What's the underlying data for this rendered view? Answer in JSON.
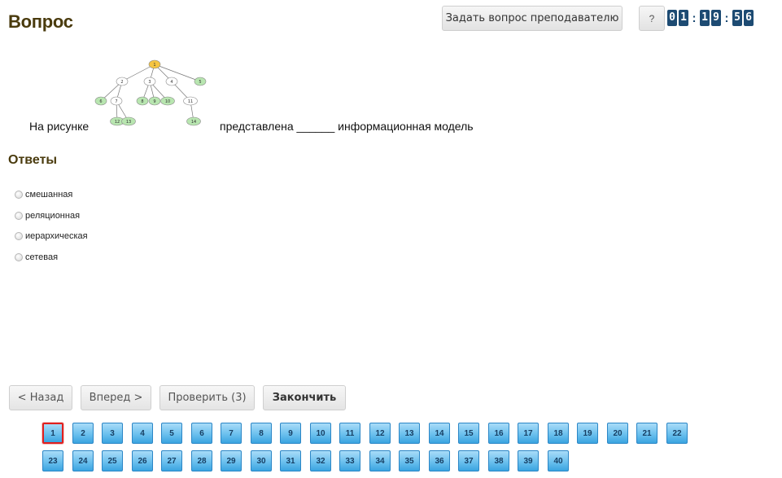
{
  "header": {
    "title": "Вопрос",
    "ask_teacher_label": "Задать вопрос преподавателю",
    "help_label": "?",
    "timer": {
      "groups": [
        [
          "0",
          "1"
        ],
        [
          "1",
          "9"
        ],
        [
          "5",
          "6"
        ]
      ],
      "separator": ":"
    }
  },
  "question": {
    "text_before": "На рисунке",
    "text_after": "представлена ______ информационная модель",
    "figure": {
      "root": "1",
      "nodes": [
        "1",
        "2",
        "3",
        "4",
        "5",
        "6",
        "7",
        "8",
        "9",
        "10",
        "11",
        "12",
        "13",
        "14"
      ],
      "edges": [
        [
          "1",
          "2"
        ],
        [
          "1",
          "3"
        ],
        [
          "1",
          "4"
        ],
        [
          "1",
          "5"
        ],
        [
          "2",
          "6"
        ],
        [
          "2",
          "7"
        ],
        [
          "3",
          "8"
        ],
        [
          "3",
          "9"
        ],
        [
          "3",
          "10"
        ],
        [
          "4",
          "11"
        ],
        [
          "7",
          "12"
        ],
        [
          "7",
          "13"
        ],
        [
          "11",
          "14"
        ]
      ],
      "colors": {
        "root": "#f5c542",
        "leaf": "#b8e6b0",
        "inner": "#ffffff"
      }
    }
  },
  "answers": {
    "title": "Ответы",
    "options": [
      "смешанная",
      "реляционная",
      "иерархическая",
      "сетевая"
    ]
  },
  "navigation": {
    "back_label": "< Назад",
    "forward_label": "Вперед >",
    "check_label": "Проверить (3)",
    "finish_label": "Закончить"
  },
  "question_nav": {
    "current": 1,
    "row1": [
      "1",
      "2",
      "3",
      "4",
      "5",
      "6",
      "7",
      "8",
      "9",
      "10",
      "11",
      "12",
      "13",
      "14",
      "15",
      "16",
      "17",
      "18",
      "19",
      "20",
      "21",
      "22"
    ],
    "row2": [
      "23",
      "24",
      "25",
      "26",
      "27",
      "28",
      "29",
      "30",
      "31",
      "32",
      "33",
      "34",
      "35",
      "36",
      "37",
      "38",
      "39",
      "40"
    ]
  },
  "colors": {
    "heading": "#4a3b0e",
    "timer_bg": "#1d4b73",
    "question_button": "#6cc0ee",
    "current_border": "#e0201f"
  }
}
